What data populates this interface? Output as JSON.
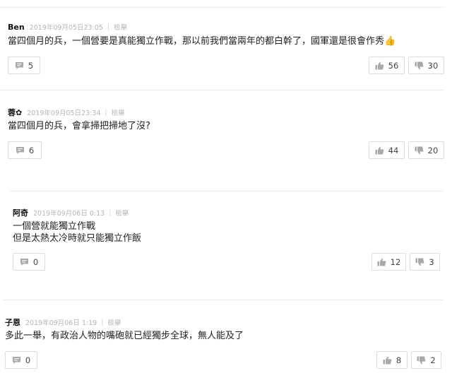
{
  "comments": [
    {
      "author": "Ben",
      "time": "2019年09月05日23:05",
      "separator": "|",
      "report": "檢舉",
      "lines": [
        "當四個月的兵，一個營要是真能獨立作戰，那以前我們當兩年的都白幹了，國軍還是很會作秀👍"
      ],
      "replies": "5",
      "likes": "56",
      "dislikes": "30"
    },
    {
      "author": "蓉✿",
      "time": "2019年09月05日23:34",
      "separator": "|",
      "report": "檢舉",
      "lines": [
        "當四個月的兵，會拿掃把掃地了沒?"
      ],
      "replies": "6",
      "likes": "44",
      "dislikes": "20"
    },
    {
      "author": "阿奇",
      "time": "2019年09月06日 0:13",
      "separator": "|",
      "report": "檢舉",
      "lines": [
        "一個營就能獨立作戰",
        "但是太熱太冷時就只能獨立作飯"
      ],
      "replies": "0",
      "likes": "12",
      "dislikes": "3"
    },
    {
      "author": "子恩",
      "time": "2019年09月06日 1:19",
      "separator": "|",
      "report": "檢舉",
      "lines": [
        "多此一舉，有政治人物的嘴砲就已經獨步全球，無人能及了"
      ],
      "replies": "0",
      "likes": "8",
      "dislikes": "2"
    }
  ],
  "icons": {
    "reply": "speech-bubble-icon",
    "like": "thumbs-up-icon",
    "dislike": "thumbs-down-icon"
  },
  "colors": {
    "icon_gray": "#a9a9a9",
    "border": "#dcdcdc",
    "meta_gray": "#b5b5b5"
  }
}
